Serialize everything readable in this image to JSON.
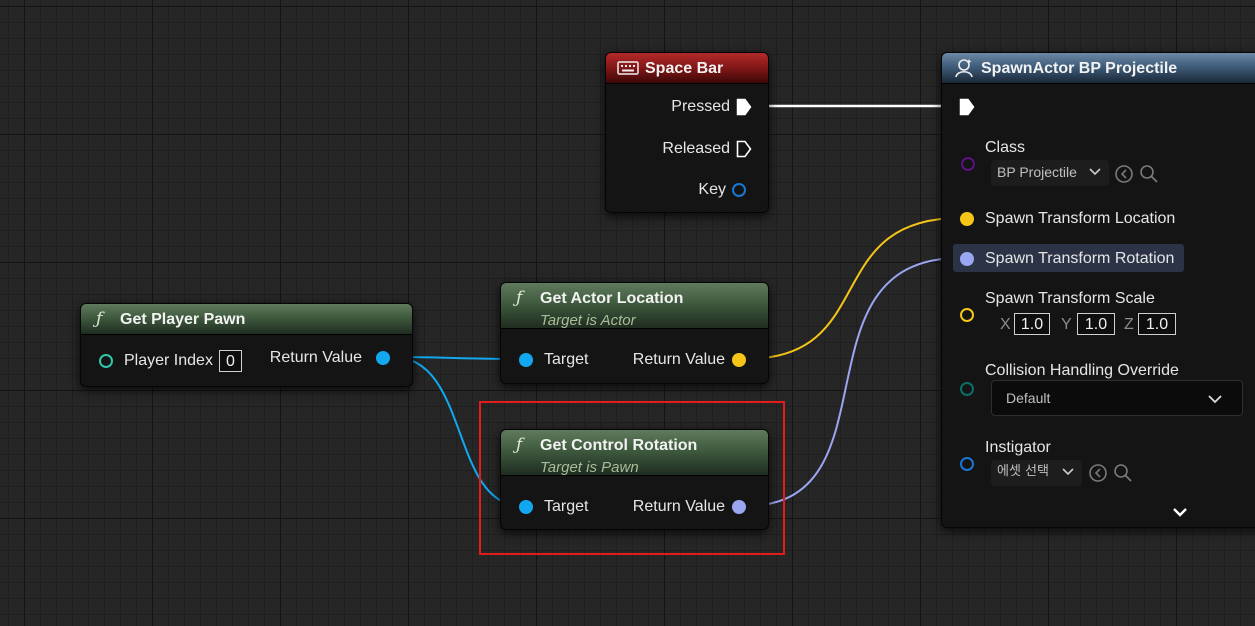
{
  "nodes": {
    "space_bar": {
      "title": "Space Bar",
      "pins": {
        "pressed": "Pressed",
        "released": "Released",
        "key": "Key"
      }
    },
    "spawn_actor": {
      "title": "SpawnActor BP Projectile",
      "class_label": "Class",
      "class_value": "BP Projectile",
      "location_label": "Spawn Transform Location",
      "rotation_label": "Spawn Transform Rotation",
      "scale_label": "Spawn Transform Scale",
      "scale": {
        "x_label": "X",
        "x": "1.0",
        "y_label": "Y",
        "y": "1.0",
        "z_label": "Z",
        "z": "1.0"
      },
      "collision_label": "Collision Handling Override",
      "collision_value": "Default",
      "instigator_label": "Instigator",
      "instigator_value": "에셋 선택"
    },
    "get_player_pawn": {
      "title": "Get Player Pawn",
      "player_index_label": "Player Index",
      "player_index_value": "0",
      "return_label": "Return Value"
    },
    "get_actor_location": {
      "title": "Get Actor Location",
      "subtitle": "Target is Actor",
      "target_label": "Target",
      "return_label": "Return Value"
    },
    "get_control_rotation": {
      "title": "Get Control Rotation",
      "subtitle": "Target is Pawn",
      "target_label": "Target",
      "return_label": "Return Value"
    }
  },
  "colors": {
    "exec": "#ffffff",
    "object_pin": "#11a8f0",
    "vector_pin": "#f5c518",
    "rotator_pin": "#9aa6f2",
    "class_pin": "#5b1080",
    "enum_pin": "#0b6e66",
    "gamepad_pin": "#1976d2",
    "highlight": "#e21c1c"
  },
  "icons": {
    "function": "function-icon",
    "keyboard": "keyboard-icon",
    "spawn": "spawn-actor-icon",
    "browse": "browse-arrow-icon",
    "search": "search-icon",
    "chevron": "chevron-down-icon"
  }
}
